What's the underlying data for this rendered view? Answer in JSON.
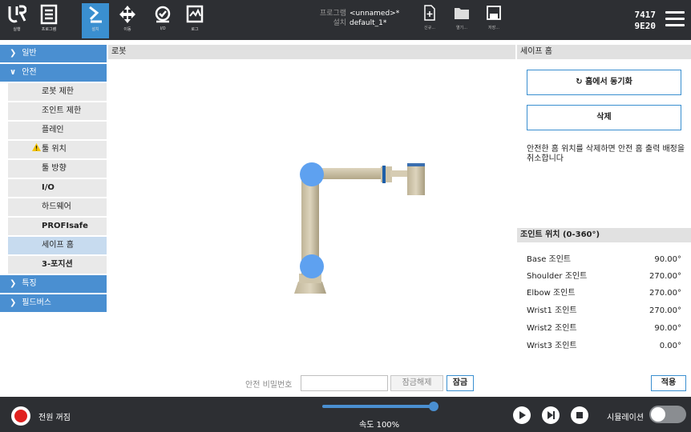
{
  "header": {
    "nav": [
      {
        "label": "실행",
        "icon": "ur-logo-icon"
      },
      {
        "label": "프로그램",
        "icon": "program-icon"
      },
      {
        "label": "설치",
        "icon": "installation-icon"
      },
      {
        "label": "이동",
        "icon": "move-icon"
      },
      {
        "label": "I/O",
        "icon": "io-icon"
      },
      {
        "label": "로그",
        "icon": "log-icon"
      }
    ],
    "program_key": "프로그램",
    "program_value": "<unnamed>*",
    "install_key": "설치",
    "install_value": "default_1*",
    "file_buttons": [
      {
        "label": "신규...",
        "icon": "new-file-icon"
      },
      {
        "label": "열기...",
        "icon": "open-folder-icon"
      },
      {
        "label": "저장...",
        "icon": "save-icon"
      }
    ],
    "serial_line1": "7417",
    "serial_line2": "9E20"
  },
  "sidebar": {
    "groups": [
      "일반",
      "안전",
      "특징",
      "필드버스"
    ],
    "safety_items": [
      "로봇 제한",
      "조인트 제한",
      "플레인",
      "툴 위치",
      "툴 방향",
      "I/O",
      "하드웨어",
      "PROFIsafe",
      "세이프 홈",
      "3-포지션"
    ],
    "selected": "세이프 홈"
  },
  "view": {
    "title": "로봇"
  },
  "password": {
    "label": "안전 비밀번호",
    "value": "",
    "unlock_label": "잠금해제",
    "lock_label": "잠금"
  },
  "right": {
    "title": "세이프 홈",
    "sync_label": "홈에서 동기화",
    "delete_label": "삭제",
    "description": "안전한 홈 위치를 삭제하면 안전 홈 출력 배정을 취소합니다",
    "joints_title": "조인트 위치 (0-360°)",
    "joints": [
      {
        "name": "Base 조인트",
        "value": "90.00°"
      },
      {
        "name": "Shoulder 조인트",
        "value": "270.00°"
      },
      {
        "name": "Elbow 조인트",
        "value": "270.00°"
      },
      {
        "name": "Wrist1 조인트",
        "value": "270.00°"
      },
      {
        "name": "Wrist2 조인트",
        "value": "90.00°"
      },
      {
        "name": "Wrist3 조인트",
        "value": "0.00°"
      }
    ],
    "apply_label": "적용"
  },
  "footer": {
    "power_label": "전원 꺼짐",
    "speed_label": "속도 100%",
    "speed_percent": 100,
    "sim_label": "시뮬레이션",
    "sim_on": false
  },
  "colors": {
    "accent": "#4a8fd1",
    "header_bg": "#2d2f33",
    "power_off": "#e0211f",
    "warning": "#f5c400"
  }
}
